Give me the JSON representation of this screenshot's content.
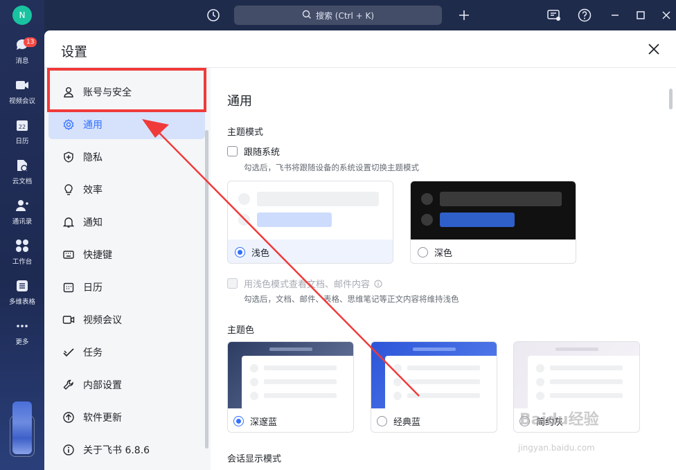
{
  "rail": {
    "avatar": "N",
    "items": [
      {
        "label": "消息",
        "icon": "chat-bubble-icon",
        "badge": "13"
      },
      {
        "label": "视频会议",
        "icon": "video-camera-icon"
      },
      {
        "label": "日历",
        "icon": "calendar-icon",
        "day": "22"
      },
      {
        "label": "云文档",
        "icon": "cloud-doc-icon"
      },
      {
        "label": "通讯录",
        "icon": "contacts-icon"
      },
      {
        "label": "工作台",
        "icon": "workplace-grid-icon"
      },
      {
        "label": "多维表格",
        "icon": "base-table-icon"
      },
      {
        "label": "更多",
        "icon": "more-dots-icon"
      }
    ]
  },
  "topbar": {
    "search_label": "搜索 (Ctrl + K)"
  },
  "dialog": {
    "title": "设置",
    "menu": [
      {
        "label": "账号与安全",
        "icon": "user-icon"
      },
      {
        "label": "通用",
        "icon": "gear-icon"
      },
      {
        "label": "隐私",
        "icon": "shield-icon"
      },
      {
        "label": "效率",
        "icon": "lightbulb-icon"
      },
      {
        "label": "通知",
        "icon": "bell-icon"
      },
      {
        "label": "快捷键",
        "icon": "keyboard-icon"
      },
      {
        "label": "日历",
        "icon": "calendar-icon"
      },
      {
        "label": "视频会议",
        "icon": "video-camera-icon"
      },
      {
        "label": "任务",
        "icon": "task-check-icon"
      },
      {
        "label": "内部设置",
        "icon": "wrench-icon"
      },
      {
        "label": "软件更新",
        "icon": "update-arrow-icon"
      },
      {
        "label": "关于飞书 6.8.6",
        "icon": "info-icon"
      }
    ],
    "active_menu": "通用"
  },
  "general": {
    "title": "通用",
    "theme_mode": {
      "heading": "主题模式",
      "follow_system": "跟随系统",
      "follow_hint": "勾选后，飞书将跟随设备的系统设置切换主题模式",
      "light": "浅色",
      "dark": "深色",
      "selected": "浅色",
      "light_docs": "用浅色模式查看文档、邮件内容",
      "light_docs_hint": "勾选后，文档、邮件、表格、思维笔记等正文内容将维持浅色"
    },
    "theme_color": {
      "heading": "主题色",
      "options": [
        "深邃蓝",
        "经典蓝",
        "简约灰"
      ],
      "selected": "深邃蓝"
    },
    "chat_mode_heading": "会话显示模式"
  },
  "colors": {
    "accent": "#3370ff",
    "annotation_red": "#f03a3a"
  },
  "watermark": {
    "text": "Baidu经验",
    "url": "jingyan.baidu.com"
  }
}
